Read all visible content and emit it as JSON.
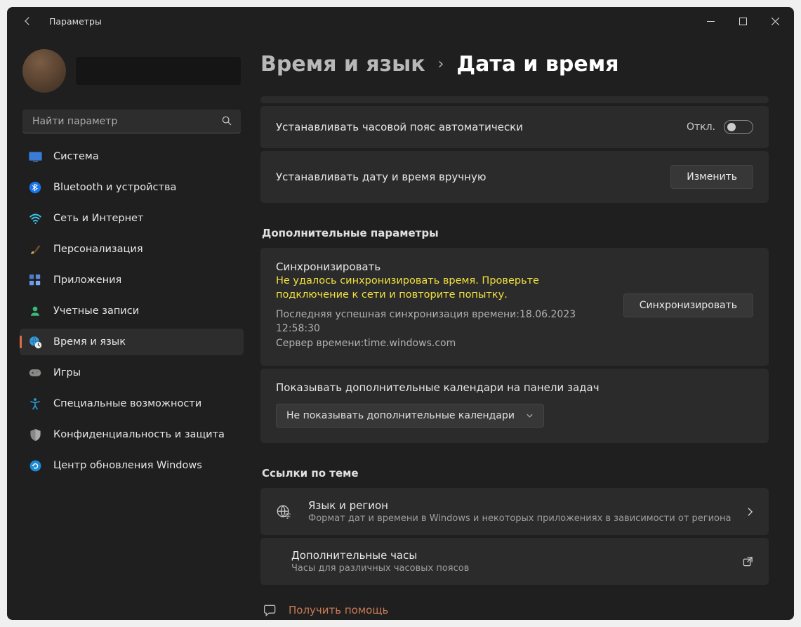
{
  "window": {
    "title": "Параметры"
  },
  "search": {
    "placeholder": "Найти параметр"
  },
  "sidebar": {
    "items": [
      {
        "label": "Система"
      },
      {
        "label": "Bluetooth и устройства"
      },
      {
        "label": "Сеть и Интернет"
      },
      {
        "label": "Персонализация"
      },
      {
        "label": "Приложения"
      },
      {
        "label": "Учетные записи"
      },
      {
        "label": "Время и язык"
      },
      {
        "label": "Игры"
      },
      {
        "label": "Специальные возможности"
      },
      {
        "label": "Конфиденциальность и защита"
      },
      {
        "label": "Центр обновления Windows"
      }
    ]
  },
  "breadcrumb": {
    "parent": "Время и язык",
    "sep": "›",
    "current": "Дата и время"
  },
  "tz_card": {
    "title": "Устанавливать часовой пояс автоматически",
    "state": "Откл."
  },
  "manual_card": {
    "title": "Устанавливать дату и время вручную",
    "button": "Изменить"
  },
  "section_advanced": "Дополнительные параметры",
  "sync": {
    "title": "Синхронизировать",
    "error": "Не удалось синхронизировать время. Проверьте подключение к сети и повторите попытку.",
    "last_label": "Последняя успешная синхронизация времени:",
    "last_value": "18.06.2023 12:58:30",
    "server_label": "Сервер времени:",
    "server_value": "time.windows.com",
    "button": "Синхронизировать"
  },
  "calendar": {
    "title": "Показывать дополнительные календари на панели задач",
    "selected": "Не показывать дополнительные календари"
  },
  "section_links": "Ссылки по теме",
  "links": {
    "lang": {
      "title": "Язык и регион",
      "sub": "Формат дат и времени в Windows и некоторых приложениях в зависимости от региона"
    },
    "clocks": {
      "title": "Дополнительные часы",
      "sub": "Часы для различных часовых поясов"
    }
  },
  "help_link": "Получить помощь"
}
